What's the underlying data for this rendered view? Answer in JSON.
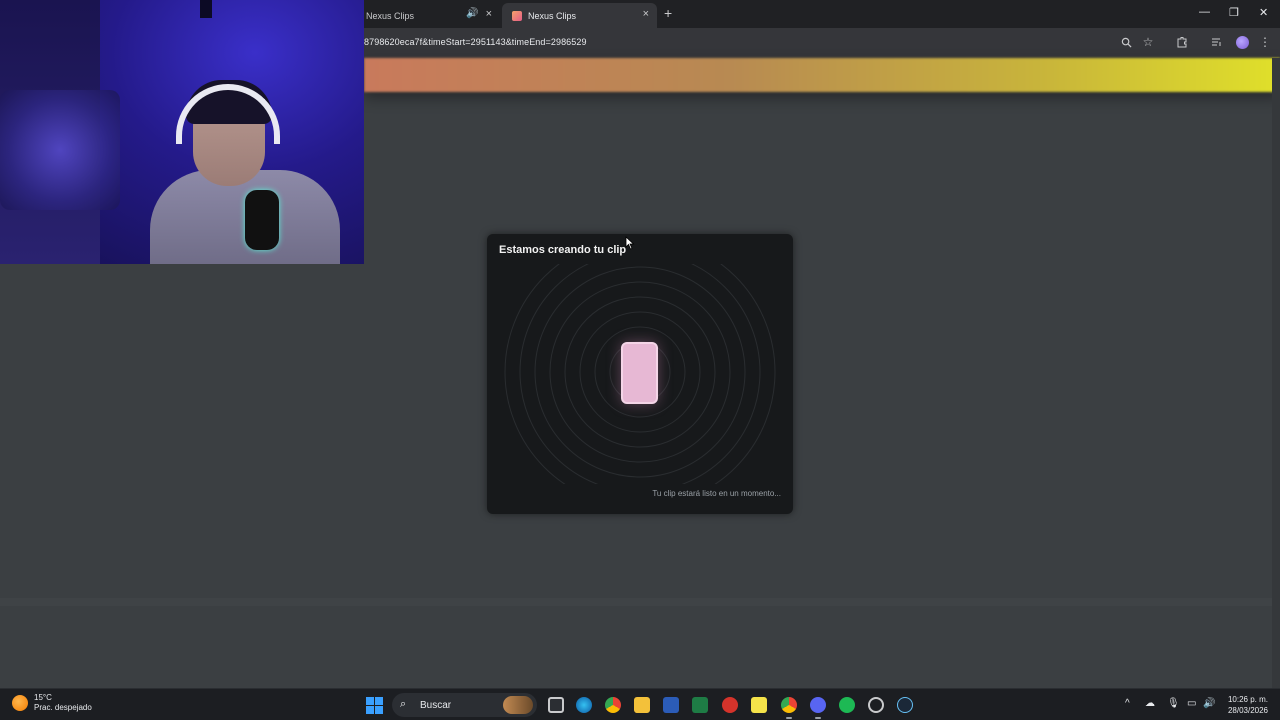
{
  "browser": {
    "tabs": [
      {
        "label": "Nexus Clips",
        "active": false,
        "playing_audio": true
      },
      {
        "label": "Nexus Clips",
        "active": true,
        "playing_audio": false
      }
    ],
    "new_tab_glyph": "+",
    "close_glyph": "×",
    "window_controls": {
      "minimize": "—",
      "maximize": "❐",
      "close": "✕"
    },
    "url": "8798620eca7f&timeStart=2951143&timeEnd=2986529",
    "toolbar_icons": [
      "zoom-icon",
      "bookmark-star-icon",
      "extensions-icon",
      "media-controls-icon",
      "profile-avatar",
      "menu-kebab-icon"
    ]
  },
  "page": {
    "banner_colors": [
      "#c97a5c",
      "#c9b63a",
      "#e0e02a"
    ],
    "modal": {
      "title": "Estamos creando tu clip",
      "status": "Tu clip estará listo en un momento...",
      "phone_color": "#e7b8d4"
    }
  },
  "webcam": {
    "description_shown": false
  },
  "taskbar": {
    "weather": {
      "temp": "15°C",
      "condition": "Prac. despejado"
    },
    "search_label": "Buscar",
    "apps": [
      "task-view",
      "edge",
      "chrome",
      "file-explorer",
      "word",
      "excel",
      "acrobat",
      "sticky-notes",
      "chrome-active",
      "discord",
      "spotify",
      "settings",
      "steam"
    ],
    "tray": {
      "chevron": "^"
    },
    "clock": {
      "time": "10:26 p. m.",
      "date": "28/03/2026"
    }
  }
}
